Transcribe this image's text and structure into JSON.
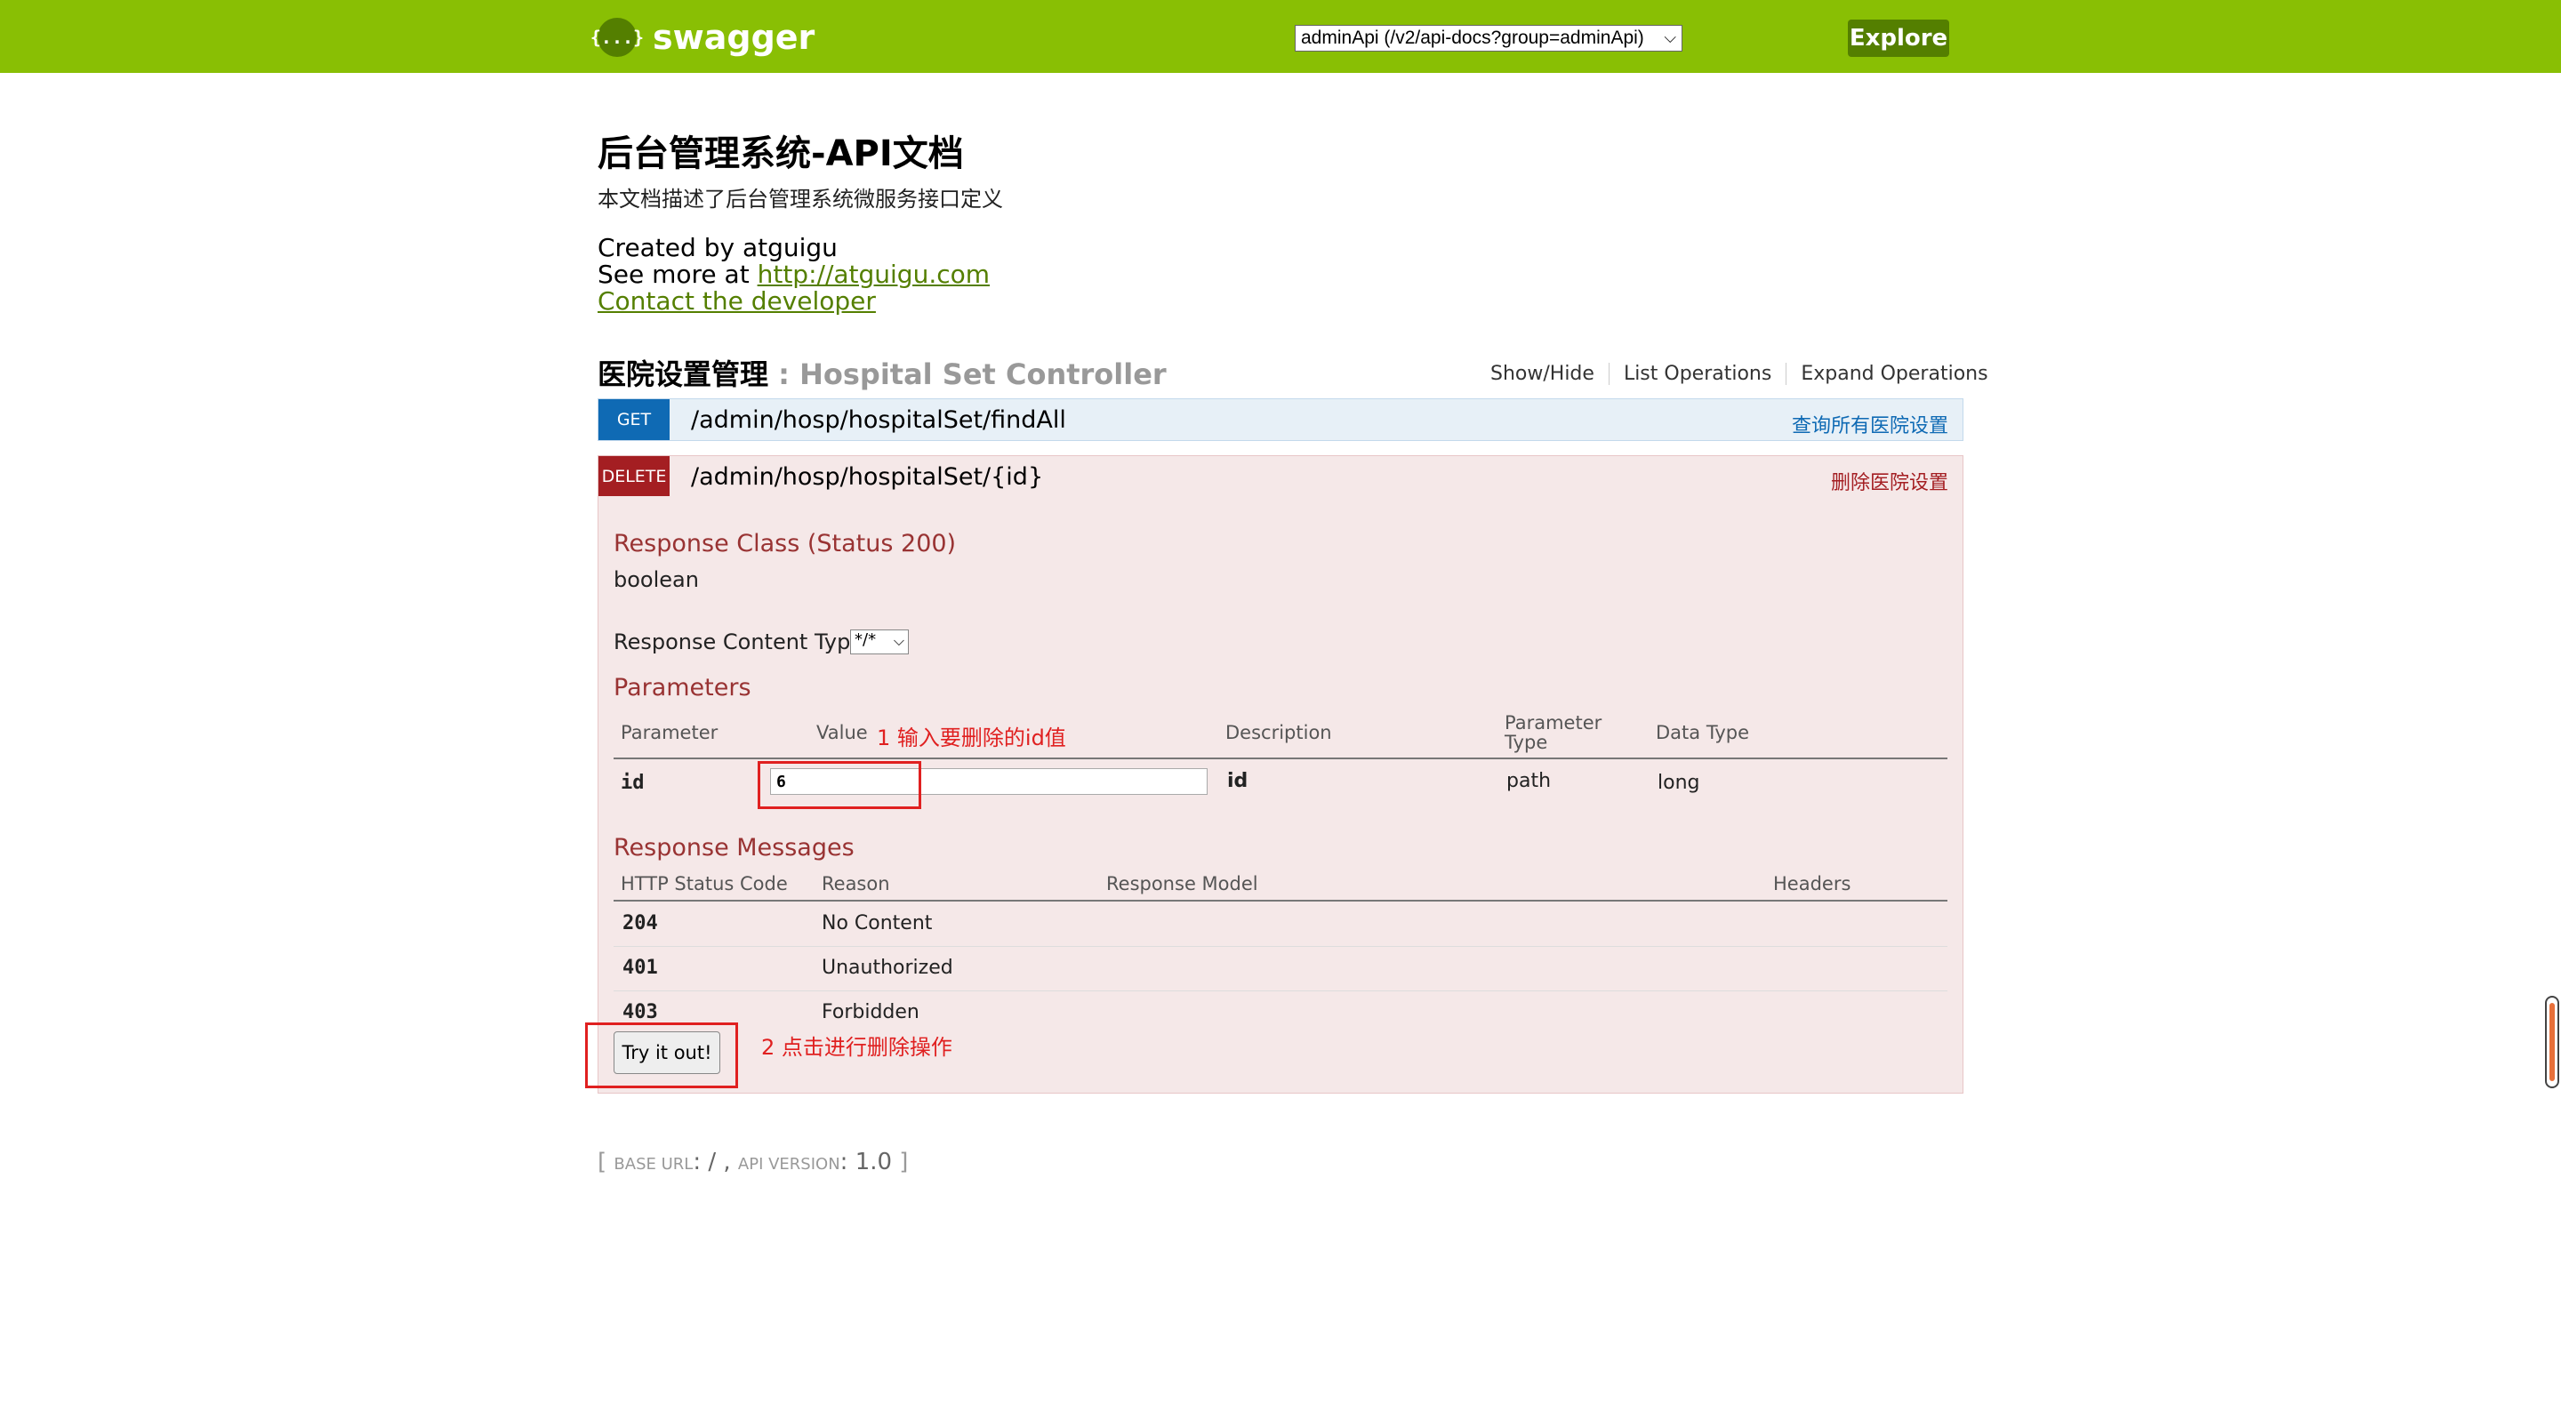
{
  "header": {
    "brand": "swagger",
    "logo_glyph": "{...}",
    "api_select_value": "adminApi (/v2/api-docs?group=adminApi)",
    "explore_label": "Explore",
    "bar_color": "#89bf04"
  },
  "info": {
    "title": "后台管理系统-API文档",
    "description": "本文档描述了后台管理系统微服务接口定义",
    "created_by": "Created by atguigu",
    "see_more_prefix": "See more at ",
    "see_more_link": "http://atguigu.com",
    "contact": "Contact the developer"
  },
  "resource": {
    "name_cn": "医院设置管理",
    "separator": " : ",
    "name_en": "Hospital Set Controller",
    "links": [
      "Show/Hide",
      "List Operations",
      "Expand Operations"
    ]
  },
  "operations": [
    {
      "method": "GET",
      "path": "/admin/hosp/hospitalSet/findAll",
      "summary": "查询所有医院设置",
      "color": "#0f6ab4"
    },
    {
      "method": "DELETE",
      "path": "/admin/hosp/hospitalSet/{id}",
      "summary": "删除医院设置",
      "color": "#a41e22",
      "response_class_title": "Response Class (Status 200)",
      "response_class_type": "boolean",
      "response_content_type_label": "Response Content Type",
      "response_content_type_value": "*/*",
      "parameters_title": "Parameters",
      "param_headers": [
        "Parameter",
        "Value",
        "Description",
        "Parameter Type",
        "Data Type"
      ],
      "param_header_type_line1": "Parameter",
      "param_header_type_line2": "Type",
      "param": {
        "name": "id",
        "value": "6",
        "description": "id",
        "type": "path",
        "data_type": "long"
      },
      "response_messages_title": "Response Messages",
      "response_headers": [
        "HTTP Status Code",
        "Reason",
        "Response Model",
        "Headers"
      ],
      "responses": [
        {
          "code": "204",
          "reason": "No Content"
        },
        {
          "code": "401",
          "reason": "Unauthorized"
        },
        {
          "code": "403",
          "reason": "Forbidden"
        }
      ],
      "try_button": "Try it out!"
    }
  ],
  "annotations": [
    "1 输入要删除的id值",
    "2 点击进行删除操作"
  ],
  "footer": {
    "open": "[ ",
    "base_url_label": "base url",
    "base_url_value": ": / , ",
    "api_version_label": "api version",
    "api_version_value": ": 1.0",
    "close": " ]"
  }
}
